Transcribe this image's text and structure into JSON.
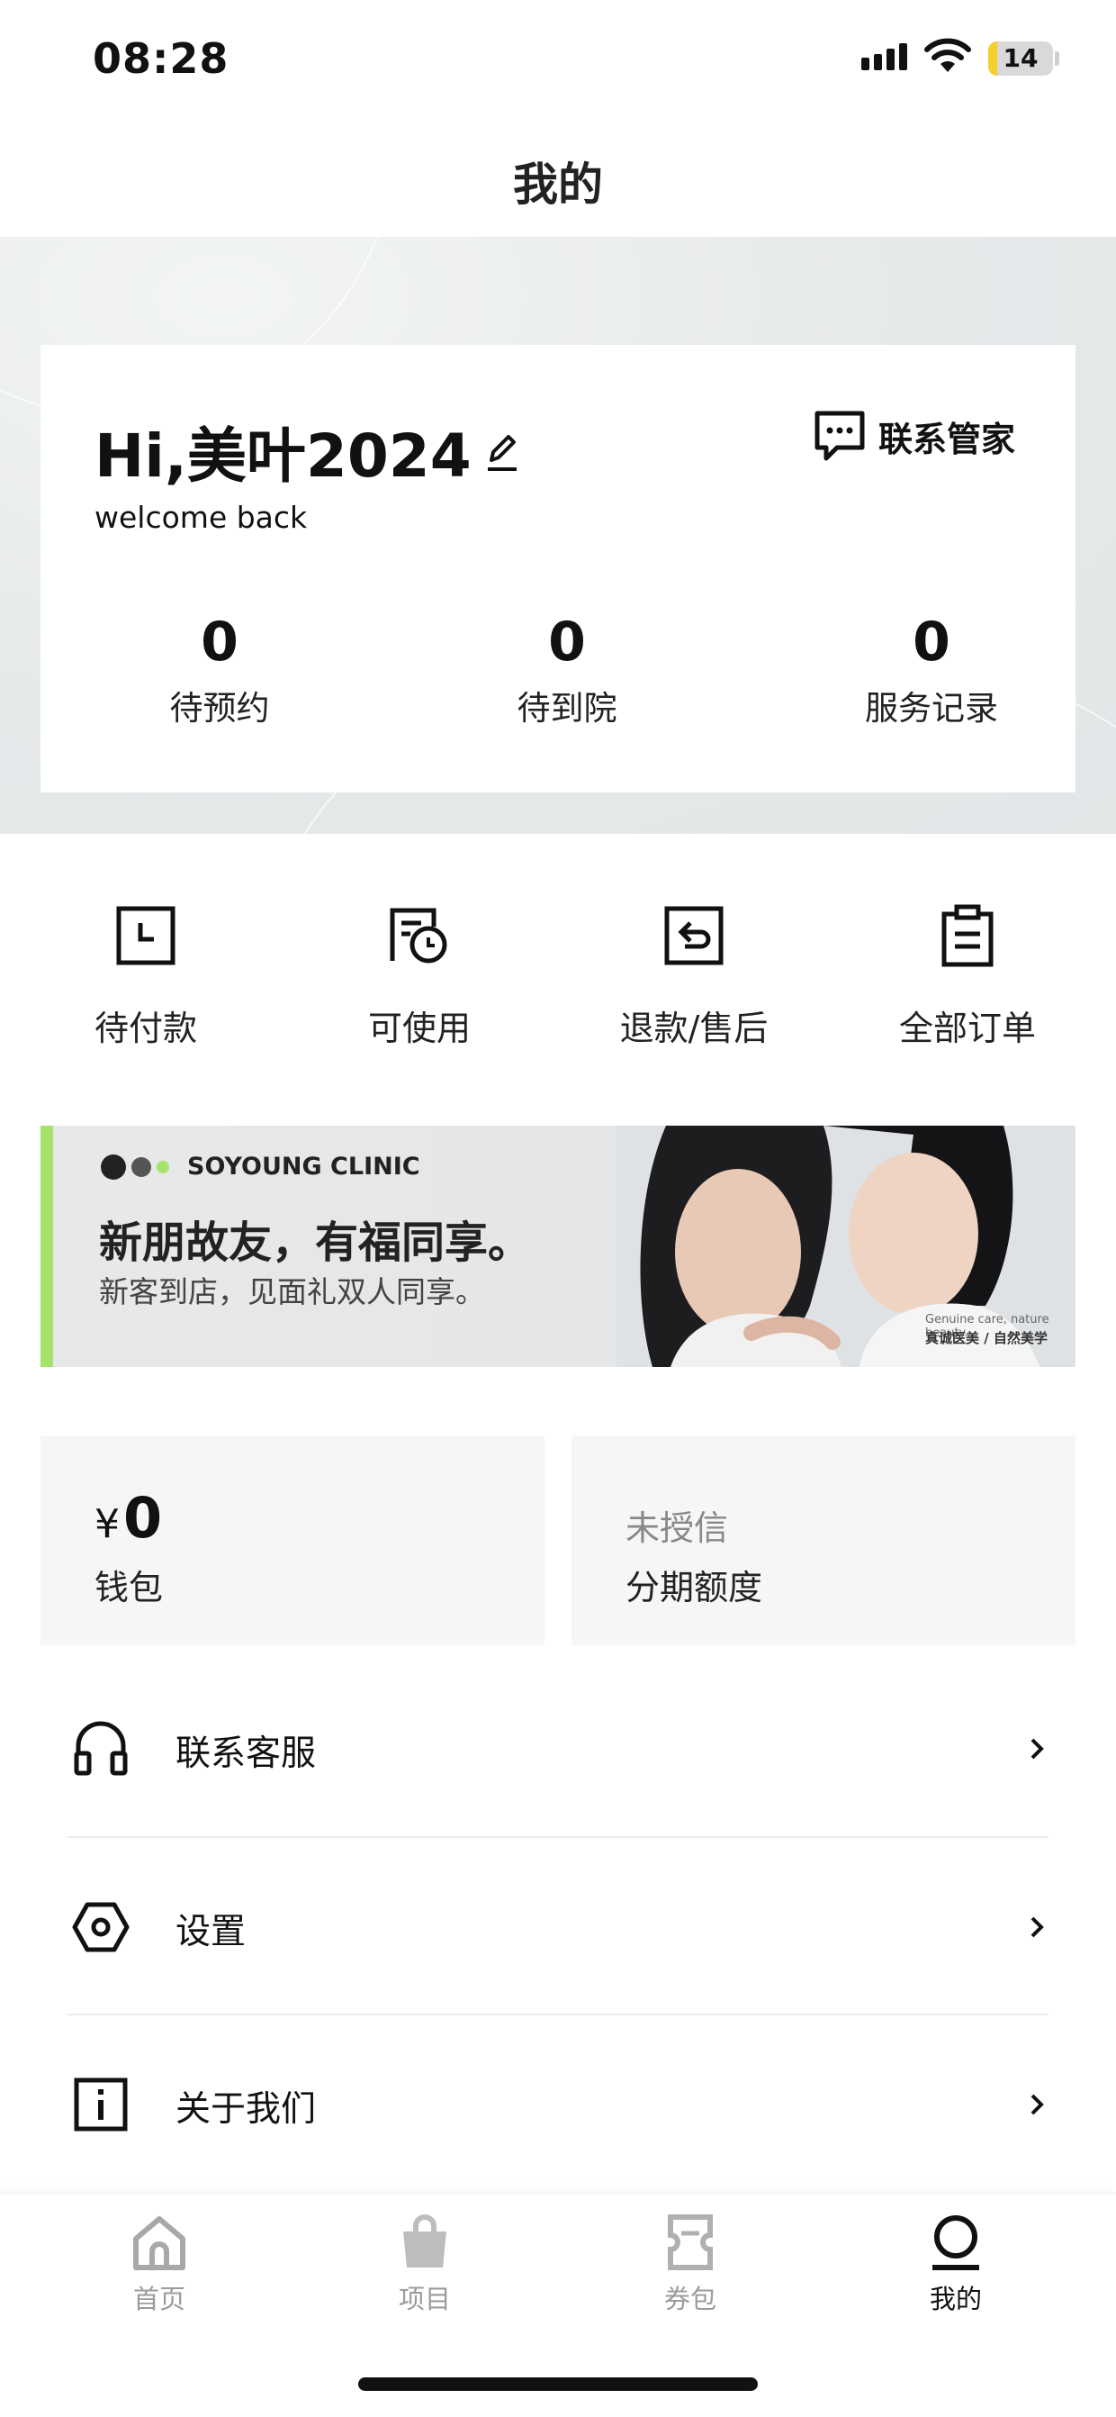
{
  "status_bar": {
    "time": "08:28",
    "battery": "14",
    "battery_percent": 14
  },
  "nav": {
    "title": "我的"
  },
  "profile": {
    "greeting": "Hi,美叶2024",
    "welcome": "welcome back",
    "contact_manager": "联系管家",
    "stats": [
      {
        "value": "0",
        "label": "待预约"
      },
      {
        "value": "0",
        "label": "待到院"
      },
      {
        "value": "0",
        "label": "服务记录"
      }
    ]
  },
  "orders": [
    {
      "label": "待付款",
      "icon": "clock-icon"
    },
    {
      "label": "可使用",
      "icon": "ticket-clock-icon"
    },
    {
      "label": "退款/售后",
      "icon": "refund-icon"
    },
    {
      "label": "全部订单",
      "icon": "clipboard-icon"
    }
  ],
  "banner": {
    "brand": "SOYOUNG CLINIC",
    "title": "新朋故友，有福同享。",
    "subtitle": "新客到店，见面礼双人同享。",
    "note_en": "Genuine care, nature beauty.",
    "note_cn": "真诚医美 / 自然美学",
    "accent_color": "#a6e36b"
  },
  "wallet": {
    "currency": "¥",
    "amount": "0",
    "label": "钱包"
  },
  "credit": {
    "status": "未授信",
    "label": "分期额度"
  },
  "menu": [
    {
      "label": "联系客服",
      "icon": "headset-icon"
    },
    {
      "label": "设置",
      "icon": "settings-hex-icon"
    },
    {
      "label": "关于我们",
      "icon": "info-icon"
    }
  ],
  "tabs": [
    {
      "label": "首页",
      "icon": "home-icon",
      "active": false
    },
    {
      "label": "项目",
      "icon": "shopping-bag-icon",
      "active": false
    },
    {
      "label": "券包",
      "icon": "coupon-icon",
      "active": false
    },
    {
      "label": "我的",
      "icon": "profile-icon",
      "active": true
    }
  ]
}
